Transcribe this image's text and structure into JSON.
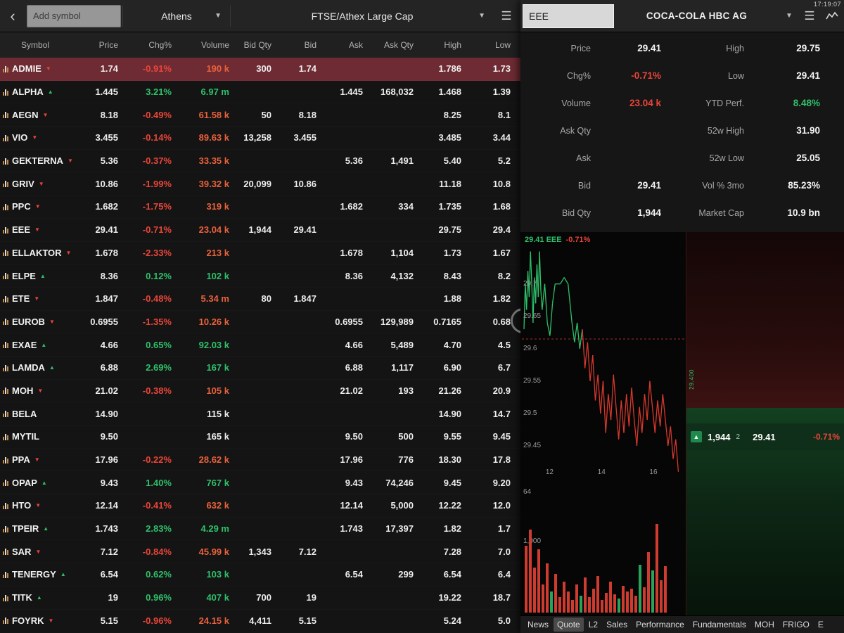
{
  "status": {
    "clock": "17:19:07"
  },
  "icons": {
    "back": "‹",
    "caret": "▼",
    "menu": "☰",
    "up": "▲",
    "down": "▼",
    "strip_arrow": "▲"
  },
  "header": {
    "add_symbol_placeholder": "Add symbol",
    "market": "Athens",
    "watchlist": "FTSE/Athex Large Cap"
  },
  "table": {
    "columns": [
      "Symbol",
      "Price",
      "Chg%",
      "Volume",
      "Bid Qty",
      "Bid",
      "Ask",
      "Ask Qty",
      "High",
      "Low"
    ],
    "rows": [
      {
        "symbol": "ADMIE",
        "dir": "down",
        "price": "1.74",
        "chg": "-0.91%",
        "volume": "190 k",
        "bid_qty": "300",
        "bid": "1.74",
        "ask": "",
        "ask_qty": "",
        "high": "1.786",
        "low": "1.73",
        "selected": true
      },
      {
        "symbol": "ALPHA",
        "dir": "up",
        "price": "1.445",
        "chg": "3.21%",
        "volume": "6.97 m",
        "bid_qty": "",
        "bid": "",
        "ask": "1.445",
        "ask_qty": "168,032",
        "high": "1.468",
        "low": "1.39",
        "selected": false
      },
      {
        "symbol": "AEGN",
        "dir": "down",
        "price": "8.18",
        "chg": "-0.49%",
        "volume": "61.58 k",
        "bid_qty": "50",
        "bid": "8.18",
        "ask": "",
        "ask_qty": "",
        "high": "8.25",
        "low": "8.1",
        "selected": false
      },
      {
        "symbol": "VIO",
        "dir": "down",
        "price": "3.455",
        "chg": "-0.14%",
        "volume": "89.63 k",
        "bid_qty": "13,258",
        "bid": "3.455",
        "ask": "",
        "ask_qty": "",
        "high": "3.485",
        "low": "3.44",
        "selected": false
      },
      {
        "symbol": "GEKTERNA",
        "dir": "down",
        "price": "5.36",
        "chg": "-0.37%",
        "volume": "33.35 k",
        "bid_qty": "",
        "bid": "",
        "ask": "5.36",
        "ask_qty": "1,491",
        "high": "5.40",
        "low": "5.2",
        "selected": false
      },
      {
        "symbol": "GRIV",
        "dir": "down",
        "price": "10.86",
        "chg": "-1.99%",
        "volume": "39.32 k",
        "bid_qty": "20,099",
        "bid": "10.86",
        "ask": "",
        "ask_qty": "",
        "high": "11.18",
        "low": "10.8",
        "selected": false
      },
      {
        "symbol": "PPC",
        "dir": "down",
        "price": "1.682",
        "chg": "-1.75%",
        "volume": "319 k",
        "bid_qty": "",
        "bid": "",
        "ask": "1.682",
        "ask_qty": "334",
        "high": "1.735",
        "low": "1.68",
        "selected": false
      },
      {
        "symbol": "EEE",
        "dir": "down",
        "price": "29.41",
        "chg": "-0.71%",
        "volume": "23.04 k",
        "bid_qty": "1,944",
        "bid": "29.41",
        "ask": "",
        "ask_qty": "",
        "high": "29.75",
        "low": "29.4",
        "selected": false
      },
      {
        "symbol": "ELLAKTOR",
        "dir": "down",
        "price": "1.678",
        "chg": "-2.33%",
        "volume": "213 k",
        "bid_qty": "",
        "bid": "",
        "ask": "1.678",
        "ask_qty": "1,104",
        "high": "1.73",
        "low": "1.67",
        "selected": false
      },
      {
        "symbol": "ELPE",
        "dir": "up",
        "price": "8.36",
        "chg": "0.12%",
        "volume": "102 k",
        "bid_qty": "",
        "bid": "",
        "ask": "8.36",
        "ask_qty": "4,132",
        "high": "8.43",
        "low": "8.2",
        "selected": false
      },
      {
        "symbol": "ETE",
        "dir": "down",
        "price": "1.847",
        "chg": "-0.48%",
        "volume": "5.34 m",
        "bid_qty": "80",
        "bid": "1.847",
        "ask": "",
        "ask_qty": "",
        "high": "1.88",
        "low": "1.82",
        "selected": false
      },
      {
        "symbol": "EUROB",
        "dir": "down",
        "price": "0.6955",
        "chg": "-1.35%",
        "volume": "10.26 k",
        "bid_qty": "",
        "bid": "",
        "ask": "0.6955",
        "ask_qty": "129,989",
        "high": "0.7165",
        "low": "0.68",
        "selected": false
      },
      {
        "symbol": "EXAE",
        "dir": "up",
        "price": "4.66",
        "chg": "0.65%",
        "volume": "92.03 k",
        "bid_qty": "",
        "bid": "",
        "ask": "4.66",
        "ask_qty": "5,489",
        "high": "4.70",
        "low": "4.5",
        "selected": false
      },
      {
        "symbol": "LAMDA",
        "dir": "up",
        "price": "6.88",
        "chg": "2.69%",
        "volume": "167 k",
        "bid_qty": "",
        "bid": "",
        "ask": "6.88",
        "ask_qty": "1,117",
        "high": "6.90",
        "low": "6.7",
        "selected": false
      },
      {
        "symbol": "MOH",
        "dir": "down",
        "price": "21.02",
        "chg": "-0.38%",
        "volume": "105 k",
        "bid_qty": "",
        "bid": "",
        "ask": "21.02",
        "ask_qty": "193",
        "high": "21.26",
        "low": "20.9",
        "selected": false
      },
      {
        "symbol": "BELA",
        "dir": "flat",
        "price": "14.90",
        "chg": "",
        "volume": "115 k",
        "bid_qty": "",
        "bid": "",
        "ask": "",
        "ask_qty": "",
        "high": "14.90",
        "low": "14.7",
        "selected": false
      },
      {
        "symbol": "MYTIL",
        "dir": "flat",
        "price": "9.50",
        "chg": "",
        "volume": "165 k",
        "bid_qty": "",
        "bid": "",
        "ask": "9.50",
        "ask_qty": "500",
        "high": "9.55",
        "low": "9.45",
        "selected": false
      },
      {
        "symbol": "PPA",
        "dir": "down",
        "price": "17.96",
        "chg": "-0.22%",
        "volume": "28.62 k",
        "bid_qty": "",
        "bid": "",
        "ask": "17.96",
        "ask_qty": "776",
        "high": "18.30",
        "low": "17.8",
        "selected": false
      },
      {
        "symbol": "OPAP",
        "dir": "up",
        "price": "9.43",
        "chg": "1.40%",
        "volume": "767 k",
        "bid_qty": "",
        "bid": "",
        "ask": "9.43",
        "ask_qty": "74,246",
        "high": "9.45",
        "low": "9.20",
        "selected": false
      },
      {
        "symbol": "HTO",
        "dir": "down",
        "price": "12.14",
        "chg": "-0.41%",
        "volume": "632 k",
        "bid_qty": "",
        "bid": "",
        "ask": "12.14",
        "ask_qty": "5,000",
        "high": "12.22",
        "low": "12.0",
        "selected": false
      },
      {
        "symbol": "TPEIR",
        "dir": "up",
        "price": "1.743",
        "chg": "2.83%",
        "volume": "4.29 m",
        "bid_qty": "",
        "bid": "",
        "ask": "1.743",
        "ask_qty": "17,397",
        "high": "1.82",
        "low": "1.7",
        "selected": false
      },
      {
        "symbol": "SAR",
        "dir": "down",
        "price": "7.12",
        "chg": "-0.84%",
        "volume": "45.99 k",
        "bid_qty": "1,343",
        "bid": "7.12",
        "ask": "",
        "ask_qty": "",
        "high": "7.28",
        "low": "7.0",
        "selected": false
      },
      {
        "symbol": "TENERGY",
        "dir": "up",
        "price": "6.54",
        "chg": "0.62%",
        "volume": "103 k",
        "bid_qty": "",
        "bid": "",
        "ask": "6.54",
        "ask_qty": "299",
        "high": "6.54",
        "low": "6.4",
        "selected": false
      },
      {
        "symbol": "TITK",
        "dir": "up",
        "price": "19",
        "chg": "0.96%",
        "volume": "407 k",
        "bid_qty": "700",
        "bid": "19",
        "ask": "",
        "ask_qty": "",
        "high": "19.22",
        "low": "18.7",
        "selected": false
      },
      {
        "symbol": "FOYRK",
        "dir": "down",
        "price": "5.15",
        "chg": "-0.96%",
        "volume": "24.15 k",
        "bid_qty": "4,411",
        "bid": "5.15",
        "ask": "",
        "ask_qty": "",
        "high": "5.24",
        "low": "5.0",
        "selected": false
      }
    ]
  },
  "panel": {
    "symbol_input": "EEE",
    "company": "COCA-COLA HBC AG",
    "quote_left": [
      {
        "label": "Price",
        "value": "29.41",
        "color": ""
      },
      {
        "label": "Chg%",
        "value": "-0.71%",
        "color": "red"
      },
      {
        "label": "Volume",
        "value": "23.04 k",
        "color": "red"
      },
      {
        "label": "Ask Qty",
        "value": "",
        "color": ""
      },
      {
        "label": "Ask",
        "value": "",
        "color": ""
      },
      {
        "label": "Bid",
        "value": "29.41",
        "color": ""
      },
      {
        "label": "Bid Qty",
        "value": "1,944",
        "color": ""
      }
    ],
    "quote_right": [
      {
        "label": "High",
        "value": "29.75",
        "color": ""
      },
      {
        "label": "Low",
        "value": "29.41",
        "color": ""
      },
      {
        "label": "YTD Perf.",
        "value": "8.48%",
        "color": "green"
      },
      {
        "label": "52w High",
        "value": "31.90",
        "color": ""
      },
      {
        "label": "52w Low",
        "value": "25.05",
        "color": ""
      },
      {
        "label": "Vol % 3mo",
        "value": "85.23%",
        "color": ""
      },
      {
        "label": "Market Cap",
        "value": "10.9 bn",
        "color": ""
      }
    ],
    "trade_strip": {
      "qty": "1,944",
      "count": "2",
      "price": "29.41",
      "chg": "-0.71%"
    },
    "depth_axis_label": "29.400",
    "tabs": [
      "News",
      "Quote",
      "L2",
      "Sales",
      "Performance",
      "Fundamentals",
      "MOH",
      "FRIGO",
      "E"
    ],
    "active_tab": "Quote"
  },
  "chart_data": {
    "type": "line",
    "legend_left": "29.41 EEE",
    "legend_chg": "-0.71%",
    "x_range": [
      11.0,
      17.1
    ],
    "y_range": [
      29.4,
      29.78
    ],
    "prev_close": 29.615,
    "y_ticks": [
      29.7,
      29.65,
      29.6,
      29.55,
      29.5,
      29.45
    ],
    "x_ticks": [
      12,
      14,
      16
    ],
    "series": [
      [
        11.0,
        29.63
      ],
      [
        11.05,
        29.7
      ],
      [
        11.1,
        29.66
      ],
      [
        11.15,
        29.72
      ],
      [
        11.2,
        29.68
      ],
      [
        11.25,
        29.75
      ],
      [
        11.3,
        29.7
      ],
      [
        11.35,
        29.64
      ],
      [
        11.4,
        29.71
      ],
      [
        11.45,
        29.67
      ],
      [
        11.5,
        29.73
      ],
      [
        11.55,
        29.68
      ],
      [
        11.6,
        29.75
      ],
      [
        11.65,
        29.69
      ],
      [
        11.7,
        29.66
      ],
      [
        11.8,
        29.7
      ],
      [
        11.9,
        29.64
      ],
      [
        12.0,
        29.62
      ],
      [
        12.1,
        29.67
      ],
      [
        12.2,
        29.7
      ],
      [
        12.4,
        29.7
      ],
      [
        12.55,
        29.71
      ],
      [
        12.7,
        29.7
      ],
      [
        12.85,
        29.64
      ],
      [
        12.95,
        29.61
      ],
      [
        13.05,
        29.64
      ],
      [
        13.15,
        29.6
      ],
      [
        13.25,
        29.63
      ],
      [
        13.35,
        29.57
      ],
      [
        13.45,
        29.61
      ],
      [
        13.55,
        29.55
      ],
      [
        13.65,
        29.59
      ],
      [
        13.75,
        29.52
      ],
      [
        13.85,
        29.56
      ],
      [
        13.95,
        29.5
      ],
      [
        14.05,
        29.55
      ],
      [
        14.15,
        29.47
      ],
      [
        14.25,
        29.53
      ],
      [
        14.35,
        29.49
      ],
      [
        14.45,
        29.56
      ],
      [
        14.55,
        29.51
      ],
      [
        14.65,
        29.46
      ],
      [
        14.75,
        29.52
      ],
      [
        14.85,
        29.47
      ],
      [
        14.95,
        29.53
      ],
      [
        15.05,
        29.48
      ],
      [
        15.15,
        29.54
      ],
      [
        15.25,
        29.49
      ],
      [
        15.35,
        29.45
      ],
      [
        15.45,
        29.51
      ],
      [
        15.55,
        29.47
      ],
      [
        15.65,
        29.53
      ],
      [
        15.75,
        29.49
      ],
      [
        15.85,
        29.55
      ],
      [
        15.95,
        29.51
      ],
      [
        16.05,
        29.47
      ],
      [
        16.15,
        29.52
      ],
      [
        16.25,
        29.48
      ],
      [
        16.35,
        29.53
      ],
      [
        16.45,
        29.49
      ],
      [
        16.55,
        29.45
      ],
      [
        16.65,
        29.48
      ],
      [
        16.75,
        29.43
      ],
      [
        16.85,
        29.46
      ],
      [
        16.95,
        29.41
      ]
    ],
    "volume_labels": [
      "64",
      "1,000"
    ],
    "volume_bars": [
      [
        95,
        "r"
      ],
      [
        118,
        "r"
      ],
      [
        64,
        "r"
      ],
      [
        90,
        "r"
      ],
      [
        40,
        "r"
      ],
      [
        70,
        "r"
      ],
      [
        30,
        "g"
      ],
      [
        55,
        "r"
      ],
      [
        22,
        "r"
      ],
      [
        44,
        "r"
      ],
      [
        30,
        "r"
      ],
      [
        18,
        "r"
      ],
      [
        40,
        "r"
      ],
      [
        24,
        "g"
      ],
      [
        50,
        "r"
      ],
      [
        22,
        "r"
      ],
      [
        34,
        "r"
      ],
      [
        52,
        "r"
      ],
      [
        18,
        "r"
      ],
      [
        28,
        "r"
      ],
      [
        44,
        "r"
      ],
      [
        26,
        "r"
      ],
      [
        20,
        "g"
      ],
      [
        38,
        "r"
      ],
      [
        30,
        "r"
      ],
      [
        34,
        "r"
      ],
      [
        24,
        "r"
      ],
      [
        68,
        "g"
      ],
      [
        36,
        "r"
      ],
      [
        86,
        "r"
      ],
      [
        60,
        "g"
      ],
      [
        126,
        "r"
      ],
      [
        46,
        "r"
      ],
      [
        66,
        "r"
      ]
    ]
  }
}
